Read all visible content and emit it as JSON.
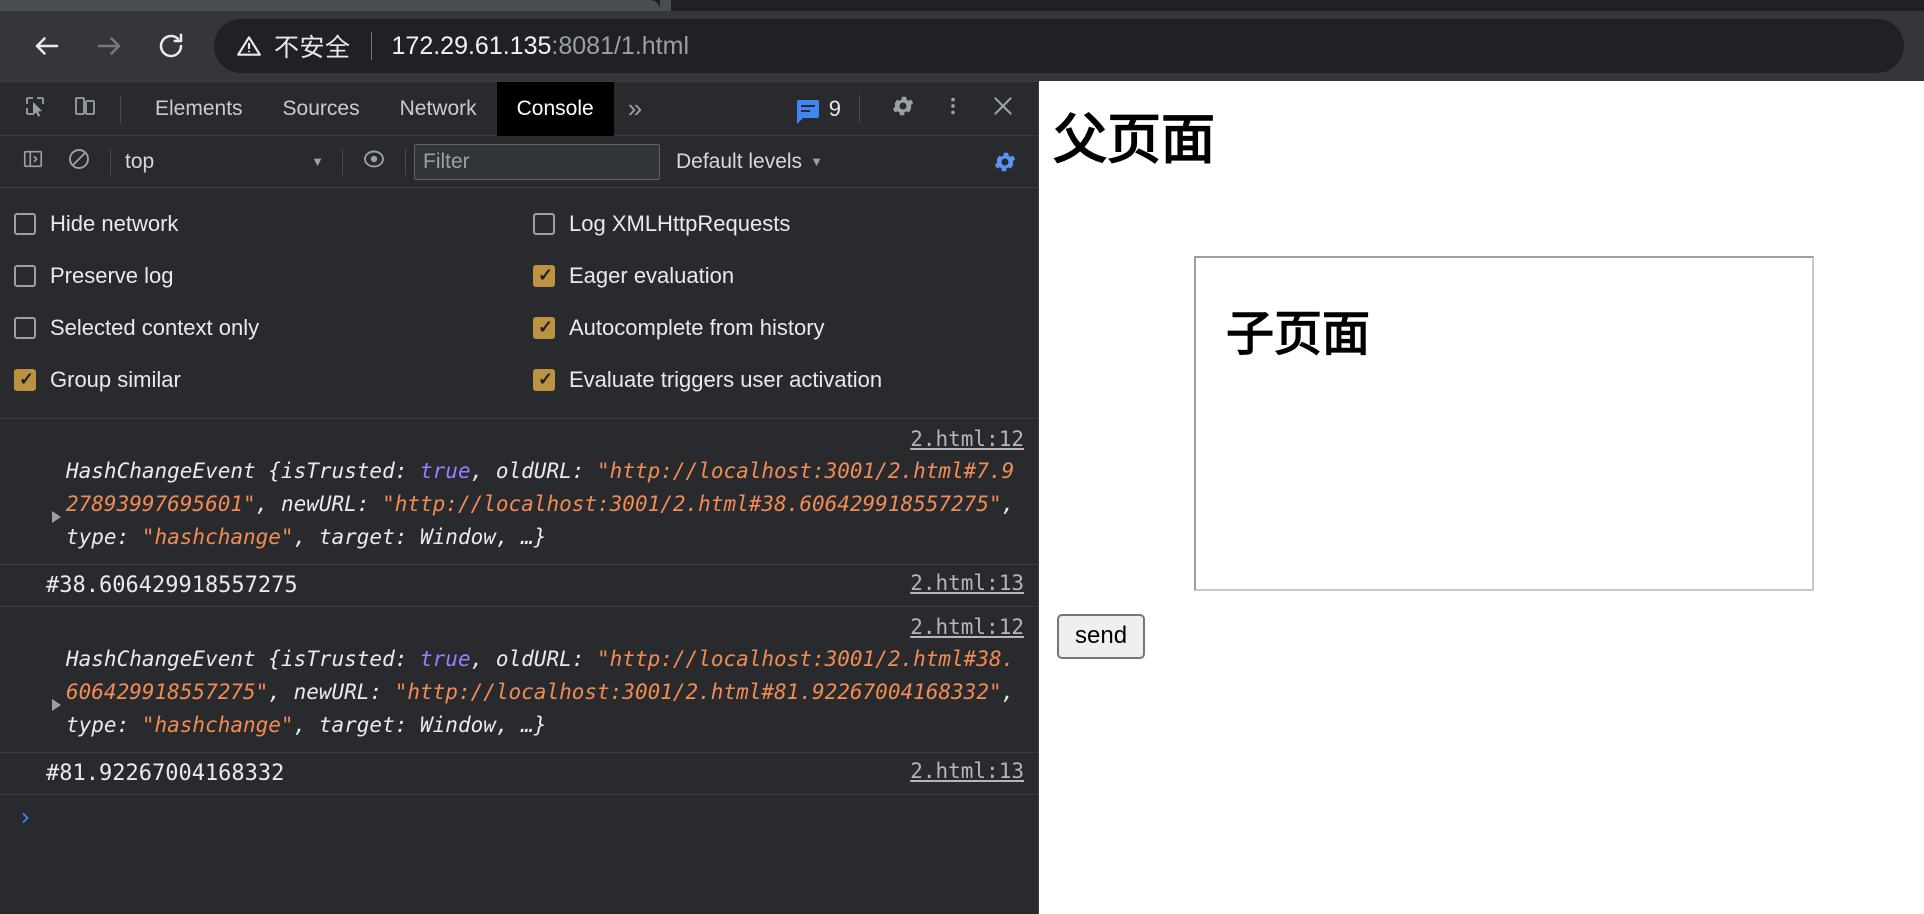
{
  "browser": {
    "nav": {
      "back_icon": "arrow-left-icon",
      "forward_icon": "arrow-right-icon",
      "reload_icon": "reload-icon"
    },
    "omnibox": {
      "security_icon": "warning-triangle-icon",
      "security_label": "不安全",
      "url_host": "172.29.61.135",
      "url_rest": ":8081/1.html"
    }
  },
  "devtools": {
    "toolbar": {
      "inspect_icon": "inspect-element-icon",
      "device_icon": "device-toolbar-icon",
      "tabs": [
        {
          "label": "Elements",
          "active": false
        },
        {
          "label": "Sources",
          "active": false
        },
        {
          "label": "Network",
          "active": false
        },
        {
          "label": "Console",
          "active": true
        }
      ],
      "more_tabs_label": "»",
      "message_count": "9",
      "message_icon": "message-badge-icon",
      "settings_icon": "gear-icon",
      "menu_icon": "kebab-menu-icon",
      "close_icon": "close-icon"
    },
    "filterbar": {
      "sidebar_icon": "console-sidebar-icon",
      "clear_icon": "clear-console-icon",
      "context": "top",
      "context_caret": "▼",
      "eye_icon": "live-expression-icon",
      "filter_placeholder": "Filter",
      "filter_value": "",
      "levels_label": "Default levels",
      "levels_caret": "▼",
      "settings_gear_icon": "gear-icon",
      "accent_blue": "#5a93f5"
    },
    "settings": {
      "left": [
        {
          "label": "Hide network",
          "checked": false
        },
        {
          "label": "Preserve log",
          "checked": false
        },
        {
          "label": "Selected context only",
          "checked": false
        },
        {
          "label": "Group similar",
          "checked": true
        }
      ],
      "right": [
        {
          "label": "Log XMLHttpRequests",
          "checked": false
        },
        {
          "label": "Eager evaluation",
          "checked": true
        },
        {
          "label": "Autocomplete from history",
          "checked": true
        },
        {
          "label": "Evaluate triggers user activation",
          "checked": true
        }
      ],
      "checked_color": "#bc9241"
    },
    "console": {
      "messages": [
        {
          "kind": "object",
          "source": "2.html:12",
          "ctor": "HashChangeEvent",
          "parts": [
            {
              "t": "plain",
              "v": "HashChangeEvent {isTrusted: "
            },
            {
              "t": "bool",
              "v": "true"
            },
            {
              "t": "plain",
              "v": ", oldURL: "
            },
            {
              "t": "str",
              "v": "\"http://localhost:3001/2.html#7.927893997695601\""
            },
            {
              "t": "plain",
              "v": ", newURL: "
            },
            {
              "t": "str",
              "v": "\"http://localhost:3001/2.html#38.606429918557275\""
            },
            {
              "t": "plain",
              "v": ", type: "
            },
            {
              "t": "str",
              "v": "\"hashchange\""
            },
            {
              "t": "plain",
              "v": ", target: Window, …}"
            }
          ]
        },
        {
          "kind": "plain",
          "source": "2.html:13",
          "text": "#38.606429918557275"
        },
        {
          "kind": "object",
          "source": "2.html:12",
          "ctor": "HashChangeEvent",
          "parts": [
            {
              "t": "plain",
              "v": "HashChangeEvent {isTrusted: "
            },
            {
              "t": "bool",
              "v": "true"
            },
            {
              "t": "plain",
              "v": ", oldURL: "
            },
            {
              "t": "str",
              "v": "\"http://localhost:3001/2.html#38.606429918557275\""
            },
            {
              "t": "plain",
              "v": ", newURL: "
            },
            {
              "t": "str",
              "v": "\"http://localhost:3001/2.html#81.92267004168332\""
            },
            {
              "t": "plain",
              "v": ", type: "
            },
            {
              "t": "str",
              "v": "\"hashchange\""
            },
            {
              "t": "plain",
              "v": ", target: Window, …}"
            }
          ]
        },
        {
          "kind": "plain",
          "source": "2.html:13",
          "text": "#81.92267004168332"
        }
      ],
      "prompt_chevron": "›",
      "string_color": "#f28b54",
      "bool_color": "#9a7fff"
    }
  },
  "page": {
    "title": "父页面",
    "iframe": {
      "title": "子页面"
    },
    "send_button": "send"
  }
}
